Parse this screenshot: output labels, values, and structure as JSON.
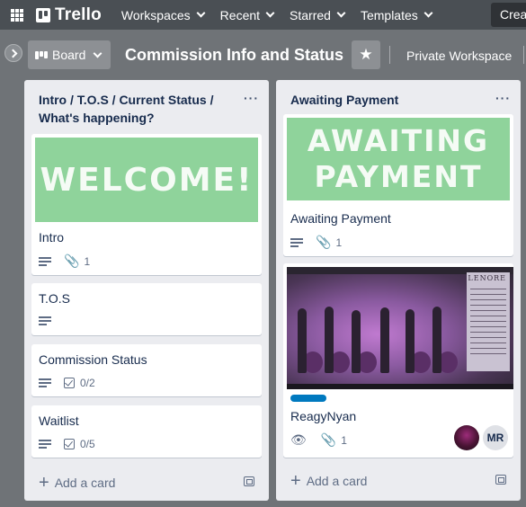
{
  "topnav": {
    "logo": "Trello",
    "menus": [
      "Workspaces",
      "Recent",
      "Starred",
      "Templates"
    ],
    "create": "Create"
  },
  "board": {
    "view": "Board",
    "title": "Commission Info and Status",
    "workspace": "Private Workspace"
  },
  "lists": [
    {
      "title": "Intro / T.O.S / Current Status / What's happening?",
      "menu": "···",
      "cards": [
        {
          "cover_text": "WELCOME!",
          "title": "Intro",
          "attachments": "1"
        },
        {
          "title": "T.O.S"
        },
        {
          "title": "Commission Status",
          "checklist": "0/2"
        },
        {
          "title": "Waitlist",
          "checklist": "0/5"
        }
      ],
      "add_card": "Add a card"
    },
    {
      "title": "Awaiting Payment",
      "menu": "···",
      "cards": [
        {
          "cover_line1": "AWAITING",
          "cover_line2": "PAYMENT",
          "title": "Awaiting Payment",
          "attachments": "1"
        },
        {
          "art_title": "LENORE",
          "title": "ReagyNyan",
          "attachments": "1",
          "member_initials": "MR"
        }
      ],
      "add_card": "Add a card"
    }
  ],
  "icons": {
    "star": "★",
    "clip": "📎",
    "eye": "👁",
    "plus": "+"
  },
  "colors": {
    "cover_green": "#8fd39b",
    "label_blue": "#0079bf"
  }
}
